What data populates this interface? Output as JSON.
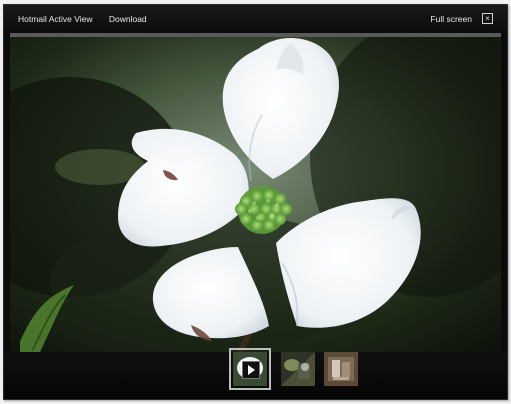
{
  "toolbar": {
    "app_label": "Hotmail Active View",
    "download_label": "Download",
    "fullscreen_label": "Full screen",
    "close_icon": "close-icon"
  },
  "filmstrip": {
    "thumbnails": [
      {
        "selected": true,
        "icon": "play-icon"
      },
      {
        "selected": false
      },
      {
        "selected": false
      }
    ]
  }
}
